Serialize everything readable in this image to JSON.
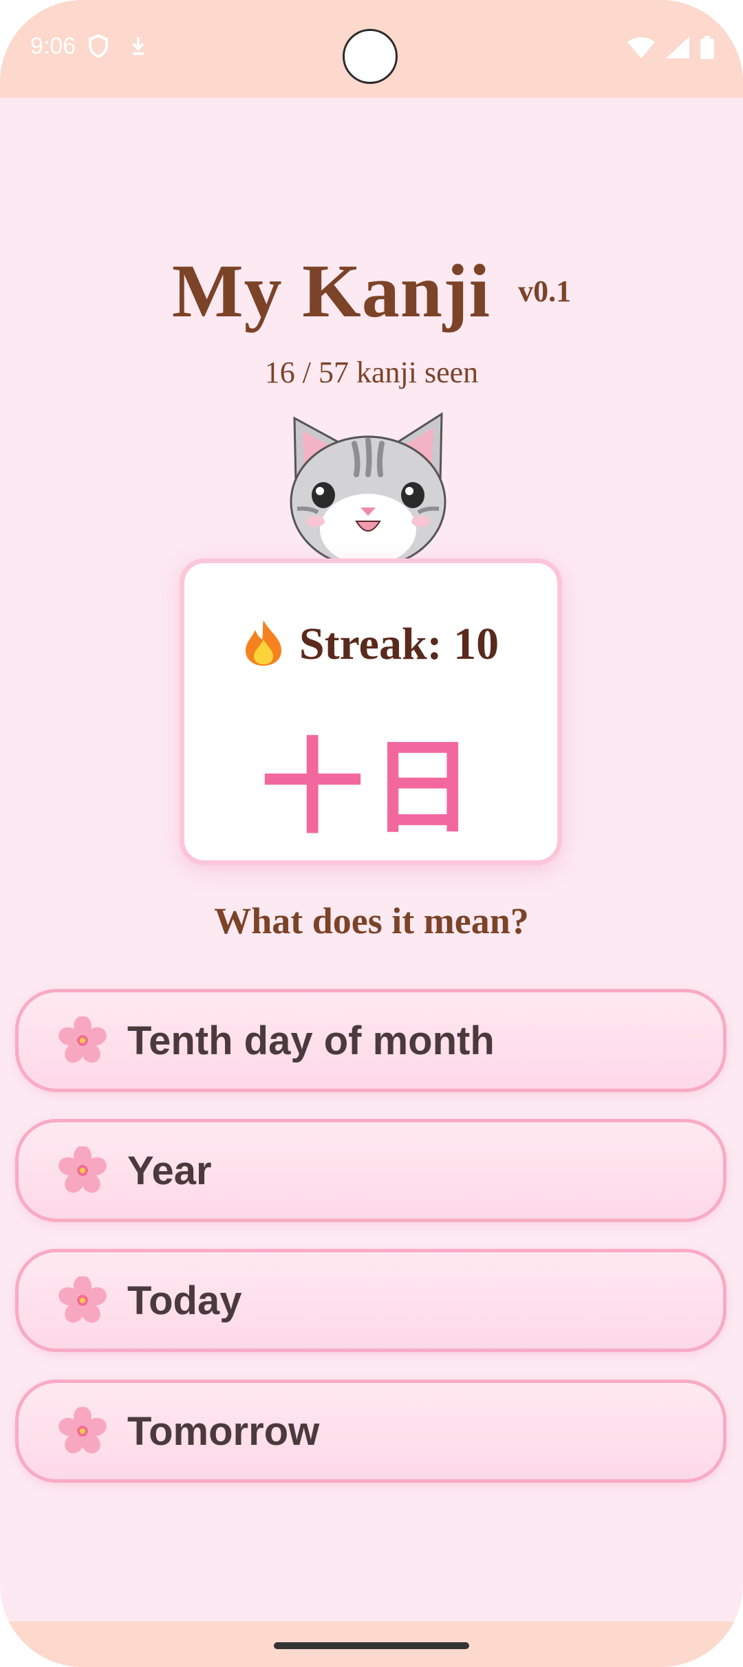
{
  "status_bar": {
    "time": "9:06",
    "left_icons": [
      "shield-icon",
      "download-icon"
    ],
    "right_icons": [
      "wifi-icon",
      "signal-icon",
      "battery-icon"
    ]
  },
  "header": {
    "title": "My Kanji",
    "version": "v0.1",
    "progress": "16 / 57 kanji seen"
  },
  "mascot": "cat-mascot",
  "card": {
    "streak_icon": "fire-icon",
    "streak_label": "Streak: 10",
    "kanji": "十日"
  },
  "question": "What does it mean?",
  "options": [
    {
      "label": "Tenth day of month",
      "icon": "sakura-icon"
    },
    {
      "label": "Year",
      "icon": "sakura-icon"
    },
    {
      "label": "Today",
      "icon": "sakura-icon"
    },
    {
      "label": "Tomorrow",
      "icon": "sakura-icon"
    }
  ],
  "colors": {
    "background": "#fde9f2",
    "system_bars": "#fcd8cd",
    "title": "#7b4327",
    "kanji": "#f2689e",
    "option_border": "#f9aac4"
  }
}
